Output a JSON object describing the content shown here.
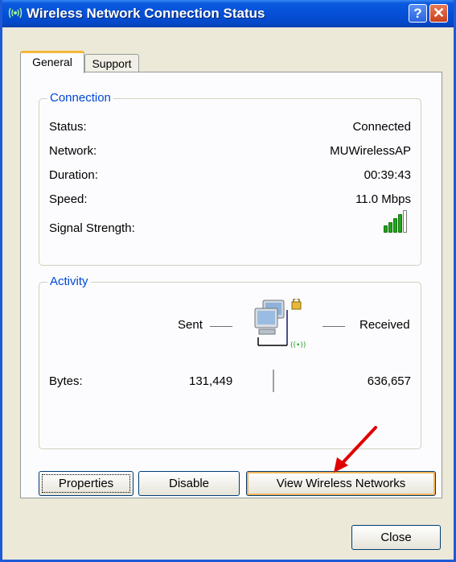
{
  "window": {
    "title": "Wireless Network Connection Status",
    "help_glyph": "?",
    "close_glyph": "✕"
  },
  "tabs": [
    {
      "label": "General",
      "active": true
    },
    {
      "label": "Support",
      "active": false
    }
  ],
  "connection": {
    "legend": "Connection",
    "rows": [
      {
        "label": "Status:",
        "value": "Connected"
      },
      {
        "label": "Network:",
        "value": "MUWirelessAP"
      },
      {
        "label": "Duration:",
        "value": "00:39:43"
      },
      {
        "label": "Speed:",
        "value": "11.0 Mbps"
      }
    ],
    "signal_label": "Signal Strength:",
    "signal_bars_lit": 4,
    "signal_bars_total": 5
  },
  "activity": {
    "legend": "Activity",
    "sent_label": "Sent",
    "received_label": "Received",
    "bytes_label": "Bytes:",
    "bytes_sent": "131,449",
    "bytes_received": "636,657"
  },
  "buttons": {
    "properties": "Properties",
    "disable": "Disable",
    "view_wireless": "View Wireless Networks",
    "close": "Close"
  },
  "colors": {
    "titlebar": "#0550d6",
    "group_legend": "#0046d5",
    "signal": "#22a41d",
    "annotation_arrow": "#e00000"
  }
}
